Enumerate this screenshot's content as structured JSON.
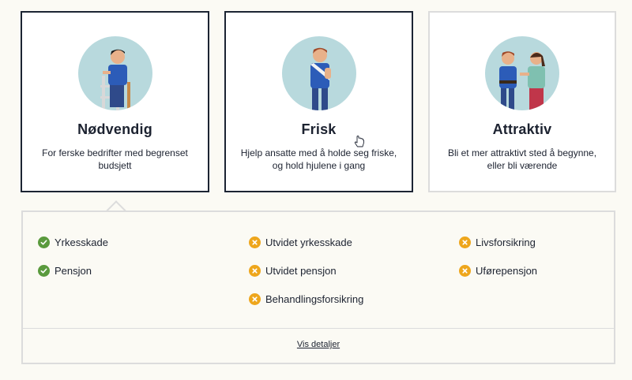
{
  "plans": [
    {
      "title": "Nødvendig",
      "desc_line1": "For ferske bedrifter med begrenset",
      "desc_line2": "budsjett",
      "illustration": "person-on-ladder"
    },
    {
      "title": "Frisk",
      "desc_line1": "Hjelp ansatte med å holde seg friske,",
      "desc_line2": "og hold hjulene i gang",
      "illustration": "person-with-arm-sling"
    },
    {
      "title": "Attraktiv",
      "desc_line1": "Bli et mer attraktivt sted å begynne,",
      "desc_line2": "eller bli værende",
      "illustration": "two-people-waving"
    }
  ],
  "coverage": {
    "col1": [
      {
        "label": "Yrkesskade",
        "status": "included",
        "icon": "check-icon"
      },
      {
        "label": "Pensjon",
        "status": "included",
        "icon": "check-icon"
      }
    ],
    "col2": [
      {
        "label": "Utvidet yrkesskade",
        "status": "not-included",
        "icon": "x-icon"
      },
      {
        "label": "Utvidet pensjon",
        "status": "not-included",
        "icon": "x-icon"
      },
      {
        "label": "Behandlingsforsikring",
        "status": "not-included",
        "icon": "x-icon"
      }
    ],
    "col3": [
      {
        "label": "Livsforsikring",
        "status": "not-included",
        "icon": "x-icon"
      },
      {
        "label": "Uførepensjon",
        "status": "not-included",
        "icon": "x-icon"
      }
    ]
  },
  "details_link": "Vis detaljer",
  "colors": {
    "included": "#5a9a3d",
    "not_included": "#eea61c",
    "border_selected": "#1c2433",
    "avatar_bg": "#b8d9dd"
  }
}
